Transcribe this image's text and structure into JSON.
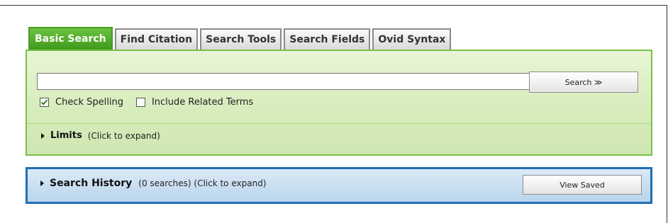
{
  "tabs": [
    {
      "label": "Basic Search",
      "active": true
    },
    {
      "label": "Find Citation",
      "active": false
    },
    {
      "label": "Search Tools",
      "active": false
    },
    {
      "label": "Search Fields",
      "active": false
    },
    {
      "label": "Ovid Syntax",
      "active": false
    }
  ],
  "search": {
    "input_value": "",
    "button_label": "Search ≫"
  },
  "options": {
    "check_spelling": {
      "label": "Check Spelling",
      "checked": true
    },
    "related_terms": {
      "label": "Include Related Terms",
      "checked": false
    }
  },
  "limits": {
    "title": "Limits",
    "hint": "(Click to expand)"
  },
  "history": {
    "title": "Search History",
    "hint": "(0 searches) (Click to expand)",
    "view_saved_label": "View Saved"
  },
  "colors": {
    "active_tab": "#4aa82a",
    "search_panel_border": "#7ac143",
    "history_panel_border": "#1f6fb5"
  }
}
